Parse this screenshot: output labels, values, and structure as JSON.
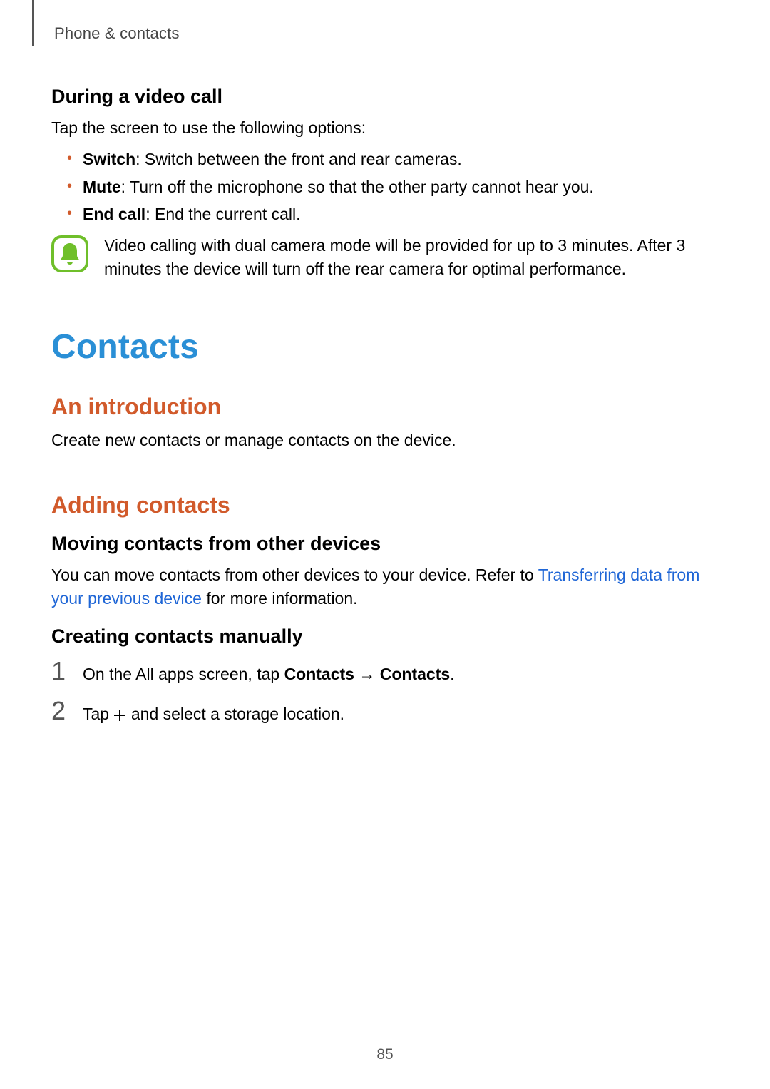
{
  "header": {
    "breadcrumb": "Phone & contacts"
  },
  "videoCall": {
    "heading": "During a video call",
    "intro": "Tap the screen to use the following options:",
    "bullets": [
      {
        "label": "Switch",
        "desc": ": Switch between the front and rear cameras."
      },
      {
        "label": "Mute",
        "desc": ": Turn off the microphone so that the other party cannot hear you."
      },
      {
        "label": "End call",
        "desc": ": End the current call."
      }
    ],
    "note": "Video calling with dual camera mode will be provided for up to 3 minutes. After 3 minutes the device will turn off the rear camera for optimal performance."
  },
  "contacts": {
    "title": "Contacts",
    "intro": {
      "heading": "An introduction",
      "text": "Create new contacts or manage contacts on the device."
    },
    "adding": {
      "heading": "Adding contacts",
      "moving": {
        "heading": "Moving contacts from other devices",
        "text_before_link": "You can move contacts from other devices to your device. Refer to ",
        "link": "Transferring data from your previous device",
        "text_after_link": " for more information."
      },
      "manual": {
        "heading": "Creating contacts manually",
        "steps": [
          {
            "num": "1",
            "pre": "On the All apps screen, tap ",
            "bold1": "Contacts",
            "arrow": " → ",
            "bold2": "Contacts",
            "post": "."
          },
          {
            "num": "2",
            "pre": "Tap ",
            "post": " and select a storage location."
          }
        ]
      }
    }
  },
  "page_number": "85"
}
